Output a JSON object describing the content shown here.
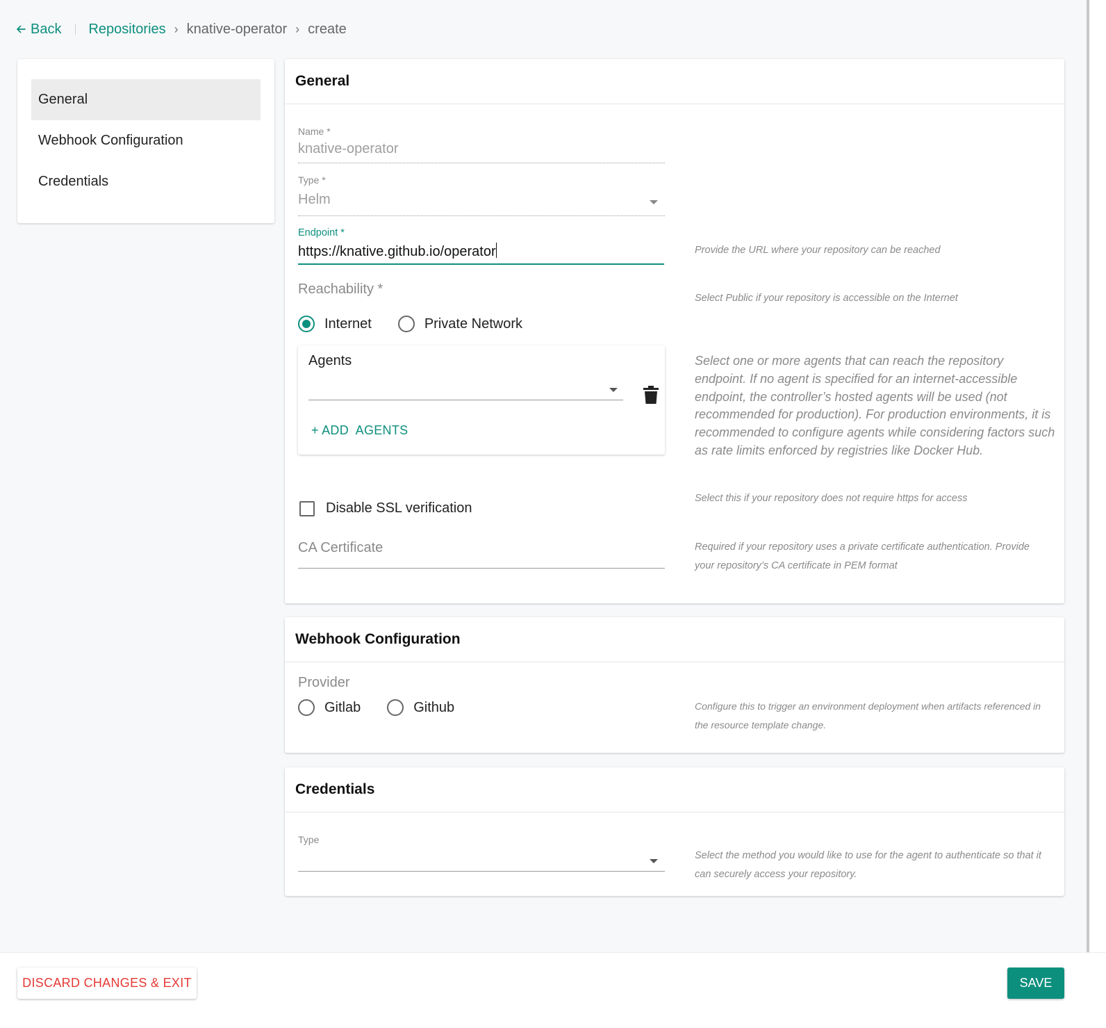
{
  "breadcrumb": {
    "back_label": "Back",
    "items": [
      "Repositories",
      "knative-operator",
      "create"
    ],
    "separator": "›"
  },
  "sidebar": {
    "items": [
      {
        "label": "General",
        "active": true
      },
      {
        "label": "Webhook Configuration",
        "active": false
      },
      {
        "label": "Credentials",
        "active": false
      }
    ]
  },
  "general": {
    "title": "General",
    "name_label": "Name *",
    "name_value": "knative-operator",
    "type_label": "Type *",
    "type_value": "Helm",
    "endpoint_label": "Endpoint *",
    "endpoint_value": "https://knative.github.io/operator",
    "endpoint_help": "Provide the URL where your repository can be reached",
    "reachability_label": "Reachability *",
    "reachability_options": [
      "Internet",
      "Private Network"
    ],
    "reachability_selected": "Internet",
    "reachability_help": "Select Public if your repository is accessible on the Internet",
    "agents_title": "Agents",
    "add_agents_label": "+ ADD  AGENTS",
    "agents_help": "Select one or more agents that can reach the repository endpoint. If no agent is specified for an internet-accessible endpoint, the controller’s hosted agents will be used (not recommended for production). For production environments, it is recommended to configure agents while considering factors such as rate limits enforced by registries like Docker Hub.",
    "ssl_label": "Disable SSL verification",
    "ssl_checked": false,
    "ssl_help": "Select this if your repository does not require https for access",
    "ca_label": "CA Certificate",
    "ca_help": "Required if your repository uses a private certificate authentication. Provide your repository’s CA certificate in PEM format"
  },
  "webhook": {
    "title": "Webhook Configuration",
    "provider_label": "Provider",
    "provider_options": [
      "Gitlab",
      "Github"
    ],
    "provider_help": "Configure this to trigger an environment deployment when artifacts referenced in the resource template change."
  },
  "credentials": {
    "title": "Credentials",
    "type_label": "Type",
    "type_help": "Select the method you would like to use for the agent to authenticate so that it can securely access your repository."
  },
  "footer": {
    "discard_label": "DISCARD CHANGES & EXIT",
    "save_label": "SAVE"
  },
  "colors": {
    "accent": "#0d8f7e",
    "danger": "#e53935"
  },
  "icons": [
    "arrow-left-icon",
    "chevron-right-icon",
    "chevron-down-icon",
    "trash-icon"
  ]
}
